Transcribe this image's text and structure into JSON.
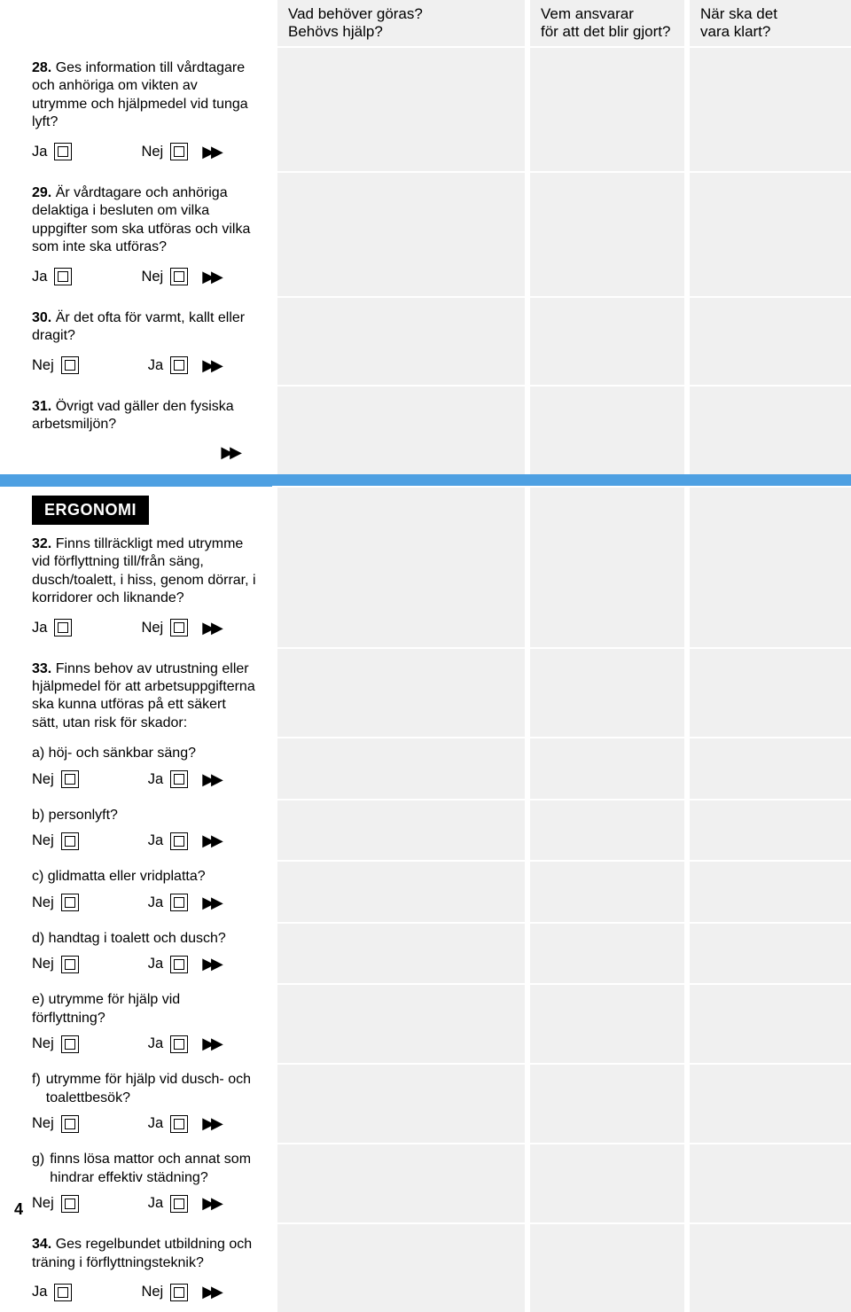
{
  "headers": {
    "col1": "Vad behöver göras?\nBehövs hjälp?",
    "col2": "Vem ansvarar\nför att det blir gjort?",
    "col3": "När ska det\nvara klart?"
  },
  "choice_labels": {
    "ja": "Ja",
    "nej": "Nej"
  },
  "arrow_glyph": "▶▶",
  "sections": [
    {
      "type": "q",
      "num": "28.",
      "text": "Ges information till vårdtagare och anhöriga om vikten av utrymme och hjälpmedel vid tunga lyft?",
      "left": "ja",
      "right": "nej"
    },
    {
      "type": "q",
      "num": "29.",
      "text": "Är vårdtagare och anhöriga delaktiga i besluten om vilka uppgifter som ska utföras och vilka som inte ska utföras?",
      "left": "ja",
      "right": "nej"
    },
    {
      "type": "q",
      "num": "30.",
      "text": "Är det ofta för varmt, kallt eller dragit?",
      "left": "nej",
      "right": "ja"
    },
    {
      "type": "q_arrow_only",
      "num": "31.",
      "text": "Övrigt vad gäller den fysiska arbetsmiljön?"
    },
    {
      "type": "header",
      "label": "ERGONOMI"
    },
    {
      "type": "q",
      "num": "32.",
      "text": "Finns tillräckligt med utrymme vid förflyttning till/från säng, dusch/toalett, i hiss, genom dörrar, i korridorer och liknande?",
      "left": "ja",
      "right": "nej"
    },
    {
      "type": "qstem",
      "num": "33.",
      "text": "Finns behov av utrustning eller hjälpmedel för att arbetsuppgifterna ska kunna utföras på ett säkert sätt, utan risk för skador:"
    },
    {
      "type": "sub",
      "text": "a) höj- och sänkbar säng?",
      "left": "nej",
      "right": "ja"
    },
    {
      "type": "sub",
      "text": "b) personlyft?",
      "left": "nej",
      "right": "ja"
    },
    {
      "type": "sub",
      "text": "c) glidmatta eller vridplatta?",
      "left": "nej",
      "right": "ja"
    },
    {
      "type": "sub",
      "text": "d) handtag i toalett och dusch?",
      "left": "nej",
      "right": "ja"
    },
    {
      "type": "sub",
      "text": "e) utrymme för hjälp vid förflyttning?",
      "left": "nej",
      "right": "ja"
    },
    {
      "type": "sub_indent",
      "text": "f) utrymme för hjälp vid dusch- och toalettbesök?",
      "indent_text": "utrymme för hjälp vid dusch- och\ntoalettbesök?",
      "prefix": "f)",
      "left": "nej",
      "right": "ja"
    },
    {
      "type": "sub_indent",
      "text": "g) finns lösa mattor och annat som hindrar effektiv städning?",
      "indent_text": "finns lösa mattor och annat som\nhindrar effektiv städning?",
      "prefix": "g)",
      "left": "nej",
      "right": "ja"
    },
    {
      "type": "q",
      "num": "34.",
      "text": "Ges regelbundet utbildning och träning i förflyttningsteknik?",
      "left": "ja",
      "right": "nej"
    }
  ],
  "page_number": "4"
}
